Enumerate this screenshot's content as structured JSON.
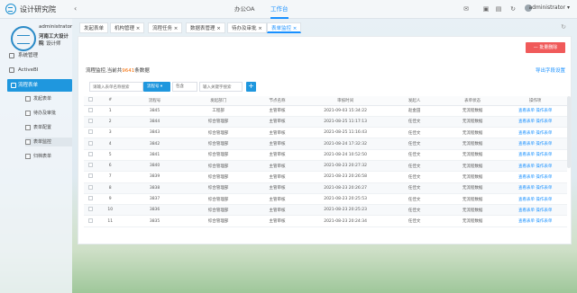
{
  "header": {
    "brand": "设计研究院",
    "nav": [
      {
        "label": "办公OA"
      },
      {
        "label": "工作台"
      }
    ],
    "user": "administrator"
  },
  "sidebar": {
    "org_user": "administrator",
    "org_line2": "河南工大设计院",
    "org_line3": "设计师",
    "items": [
      {
        "label": "系统管理"
      },
      {
        "label": "ActiveBI"
      },
      {
        "label": "流程表单"
      }
    ],
    "subitems": [
      {
        "label": "发起表单"
      },
      {
        "label": "待办及审批"
      },
      {
        "label": "表单配置"
      },
      {
        "label": "表单监控"
      },
      {
        "label": "归档表单"
      }
    ]
  },
  "tabs": [
    {
      "label": "发起表单"
    },
    {
      "label": "机构管理 ×"
    },
    {
      "label": "流程任务 ×"
    },
    {
      "label": "数据表管理 ×"
    },
    {
      "label": "待办及审批 ×"
    },
    {
      "label": "表单监控 ×"
    }
  ],
  "toolbar": {
    "batch_delete": "— 批量删除",
    "info_prefix": "流程监控,当前共",
    "info_count": "9641",
    "info_suffix": "条数据",
    "export": "导出字段设置",
    "search_placeholder": "请输入表单名称搜索",
    "select_label": "流程号 ▾",
    "cond_label": "包含",
    "keyword_placeholder": "输入关键字搜索",
    "plus": "+"
  },
  "table": {
    "headers": [
      "",
      "#",
      "流程号",
      "发起部门",
      "节点名称",
      "审核时间",
      "发起人",
      "表单状态",
      "操作项"
    ],
    "rows": [
      {
        "n": "1",
        "id": "3845",
        "dept": "工程部",
        "node": "主管审核",
        "time": "2021-09-03 15:34:22",
        "user": "赵金田",
        "status": "无流程数据",
        "op": "查看表单  操作表单"
      },
      {
        "n": "2",
        "id": "3844",
        "dept": "综合管理部",
        "node": "主管审核",
        "time": "2021-08-25 11:17:13",
        "user": "任佳文",
        "status": "无流程数据",
        "op": "查看表单  操作表单"
      },
      {
        "n": "3",
        "id": "3843",
        "dept": "综合管理部",
        "node": "主管审核",
        "time": "2021-08-25 11:16:43",
        "user": "任佳文",
        "status": "无流程数据",
        "op": "查看表单  操作表单"
      },
      {
        "n": "4",
        "id": "3842",
        "dept": "综合管理部",
        "node": "主管审核",
        "time": "2021-08-24 17:32:32",
        "user": "任佳文",
        "status": "无流程数据",
        "op": "查看表单  操作表单"
      },
      {
        "n": "5",
        "id": "3841",
        "dept": "综合管理部",
        "node": "主管审核",
        "time": "2021-08-24 10:52:50",
        "user": "任佳文",
        "status": "无流程数据",
        "op": "查看表单  操作表单"
      },
      {
        "n": "6",
        "id": "3840",
        "dept": "综合管理部",
        "node": "主管审核",
        "time": "2021-08-23 20:27:32",
        "user": "任佳文",
        "status": "无流程数据",
        "op": "查看表单  操作表单"
      },
      {
        "n": "7",
        "id": "3839",
        "dept": "综合管理部",
        "node": "主管审核",
        "time": "2021-08-23 20:26:58",
        "user": "任佳文",
        "status": "无流程数据",
        "op": "查看表单  操作表单"
      },
      {
        "n": "8",
        "id": "3838",
        "dept": "综合管理部",
        "node": "主管审核",
        "time": "2021-08-23 20:26:27",
        "user": "任佳文",
        "status": "无流程数据",
        "op": "查看表单  操作表单"
      },
      {
        "n": "9",
        "id": "3837",
        "dept": "综合管理部",
        "node": "主管审核",
        "time": "2021-08-23 20:25:53",
        "user": "任佳文",
        "status": "无流程数据",
        "op": "查看表单  操作表单"
      },
      {
        "n": "10",
        "id": "3836",
        "dept": "综合管理部",
        "node": "主管审核",
        "time": "2021-08-23 20:25:23",
        "user": "任佳文",
        "status": "无流程数据",
        "op": "查看表单  操作表单"
      },
      {
        "n": "11",
        "id": "3835",
        "dept": "综合管理部",
        "node": "主管审核",
        "time": "2021-08-23 20:24:34",
        "user": "任佳文",
        "status": "无流程数据",
        "op": "查看表单  操作表单"
      }
    ]
  }
}
